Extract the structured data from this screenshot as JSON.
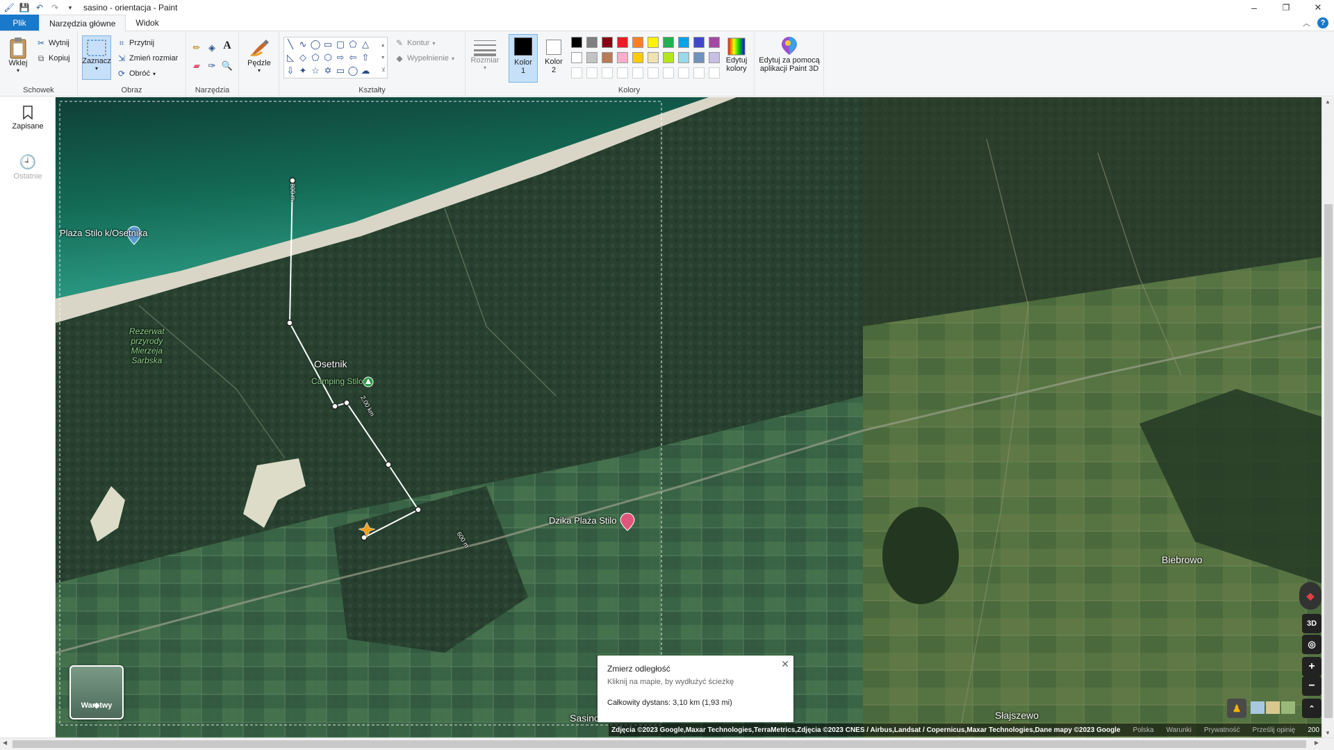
{
  "window": {
    "title": "sasino - orientacja - Paint",
    "minimize": "–",
    "maximize": "❐",
    "close": "✕"
  },
  "tabs": {
    "file": "Plik",
    "home": "Narzędzia główne",
    "view": "Widok"
  },
  "ribbon": {
    "clipboard": {
      "paste": "Wklej",
      "cut": "Wytnij",
      "copy": "Kopiuj",
      "group": "Schowek"
    },
    "image": {
      "select": "Zaznacz",
      "crop": "Przytnij",
      "resize": "Zmień rozmiar",
      "rotate": "Obróć",
      "group": "Obraz"
    },
    "tools": {
      "group": "Narzędzia"
    },
    "brushes": {
      "label": "Pędzle"
    },
    "shapes": {
      "outline": "Kontur",
      "fill": "Wypełnienie",
      "group": "Kształty"
    },
    "size": {
      "label": "Rozmiar"
    },
    "color1": {
      "label": "Kolor",
      "num": "1"
    },
    "color2": {
      "label": "Kolor",
      "num": "2"
    },
    "colors": {
      "group": "Kolory",
      "edit_line1": "Edytuj",
      "edit_line2": "kolory"
    },
    "paint3d": {
      "line1": "Edytuj za pomocą",
      "line2": "aplikacji Paint 3D"
    }
  },
  "palette_row1": [
    "#000000",
    "#7f7f7f",
    "#880015",
    "#ed1c24",
    "#ff7f27",
    "#fff200",
    "#22b14c",
    "#00a2e8",
    "#3f48cc",
    "#a349a4"
  ],
  "palette_row2": [
    "#ffffff",
    "#c3c3c3",
    "#b97a57",
    "#ffaec9",
    "#ffc90e",
    "#efe4b0",
    "#b5e61d",
    "#99d9ea",
    "#7092be",
    "#c8bfe7"
  ],
  "side": {
    "saved": "Zapisane",
    "recent": "Ostatnie"
  },
  "map": {
    "labels": {
      "beach": "Plaża Stilo k/Osetnika",
      "reserve_l1": "Rezerwat",
      "reserve_l2": "przyrody",
      "reserve_l3": "Mierzeja",
      "reserve_l4": "Sarbska",
      "osetnik": "Osetnik",
      "camping": "Camping Stilo",
      "dzika": "Dzika Plaża Stilo",
      "biebrowo": "Biebrowo",
      "slajszewo": "Słajszewo",
      "sasino": "Sasino"
    },
    "distances": {
      "d1": "800 m",
      "d2": "2,00 km",
      "d3": "600 m"
    },
    "measure": {
      "title": "Zmierz odległość",
      "hint": "Kliknij na mapie, by wydłużyć ścieżkę",
      "total": "Całkowity dystans: 3,10 km (1,93 mi)"
    },
    "layers": "Warstwy",
    "controls": {
      "three_d": "3D",
      "zoom_in": "+",
      "zoom_out": "−"
    },
    "attribution": {
      "imagery": "Zdjęcia ©2023 Google,Maxar Technologies,TerraMetrics,Zdjęcia ©2023 CNES / Airbus,Landsat / Copernicus,Maxar Technologies,Dane mapy ©2023 Google",
      "country": "Polska",
      "terms": "Warunki",
      "privacy": "Prywatność",
      "feedback": "Prześlij opinię",
      "scale": "200 m"
    }
  }
}
